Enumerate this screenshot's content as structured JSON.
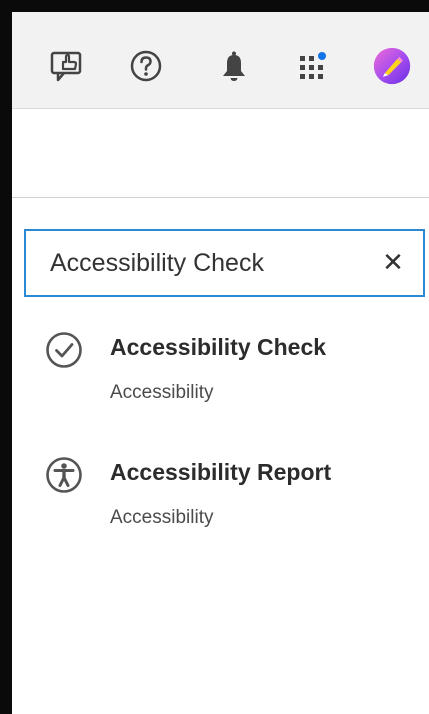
{
  "toolbar": {
    "icons": [
      {
        "name": "comment-share-icon"
      },
      {
        "name": "help-icon"
      },
      {
        "name": "notifications-bell-icon"
      },
      {
        "name": "apps-grid-icon",
        "badge_color": "#1473e6"
      },
      {
        "name": "user-avatar-icon"
      }
    ]
  },
  "search": {
    "value": "Accessibility Check",
    "clear_glyph": "✕"
  },
  "results": [
    {
      "title": "Accessibility Check",
      "subtitle": "Accessibility",
      "icon": "check-circle-icon"
    },
    {
      "title": "Accessibility Report",
      "subtitle": "Accessibility",
      "icon": "accessibility-person-icon"
    }
  ],
  "colors": {
    "accent": "#2d8ad2",
    "toolbar_bg": "#f2f2f2",
    "icon_gray": "#444444"
  }
}
